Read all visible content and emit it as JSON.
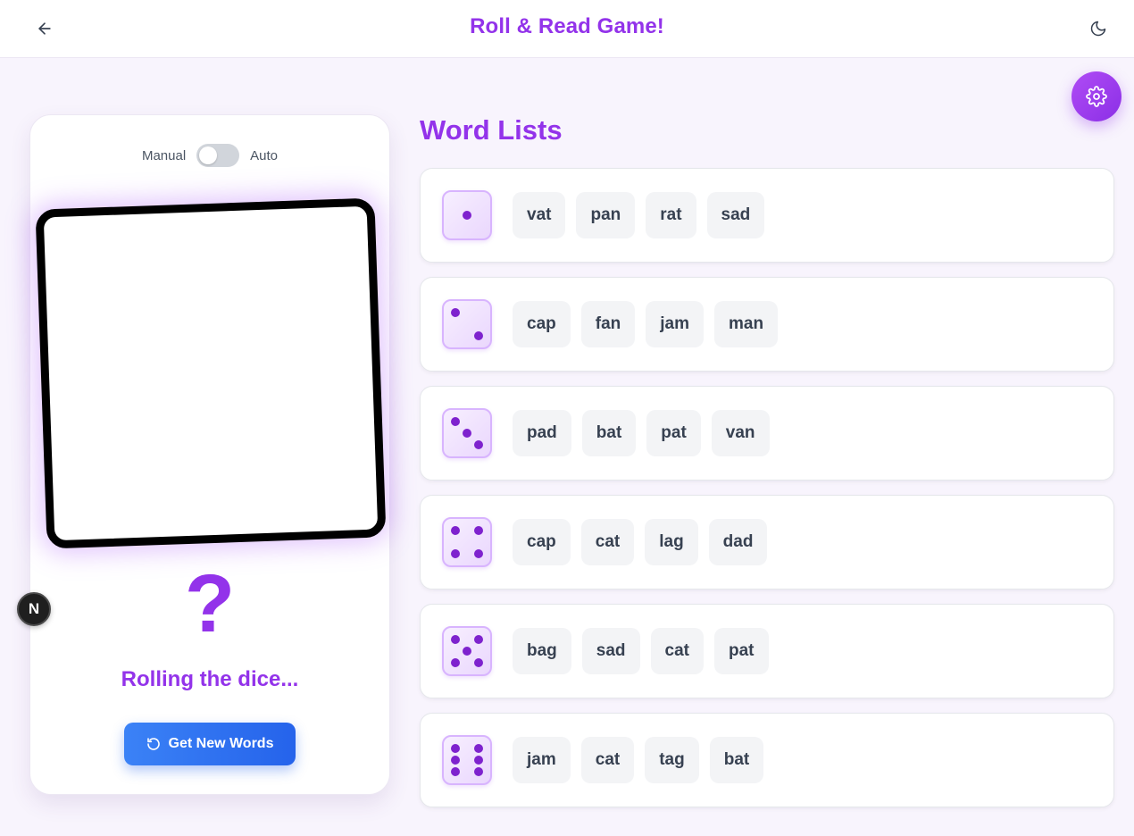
{
  "header": {
    "title": "Roll & Read Game!",
    "back_icon": "arrow-left-icon",
    "theme_icon": "moon-icon"
  },
  "settings": {
    "icon": "gear-icon"
  },
  "dice_panel": {
    "mode_left": "Manual",
    "mode_right": "Auto",
    "auto_enabled": false,
    "question_mark": "?",
    "status": "Rolling the dice...",
    "button_label": "Get New Words",
    "button_icon": "refresh-icon"
  },
  "dev_badge": {
    "label": "N"
  },
  "word_lists": {
    "heading": "Word Lists",
    "rows": [
      {
        "pips": 1,
        "words": [
          "vat",
          "pan",
          "rat",
          "sad"
        ]
      },
      {
        "pips": 2,
        "words": [
          "cap",
          "fan",
          "jam",
          "man"
        ]
      },
      {
        "pips": 3,
        "words": [
          "pad",
          "bat",
          "pat",
          "van"
        ]
      },
      {
        "pips": 4,
        "words": [
          "cap",
          "cat",
          "lag",
          "dad"
        ]
      },
      {
        "pips": 5,
        "words": [
          "bag",
          "sad",
          "cat",
          "pat"
        ]
      },
      {
        "pips": 6,
        "words": [
          "jam",
          "cat",
          "tag",
          "bat"
        ]
      }
    ]
  },
  "colors": {
    "accent": "#9333ea",
    "button_blue": "#2563eb",
    "pip": "#7e22ce",
    "background": "#f8f4fd"
  }
}
